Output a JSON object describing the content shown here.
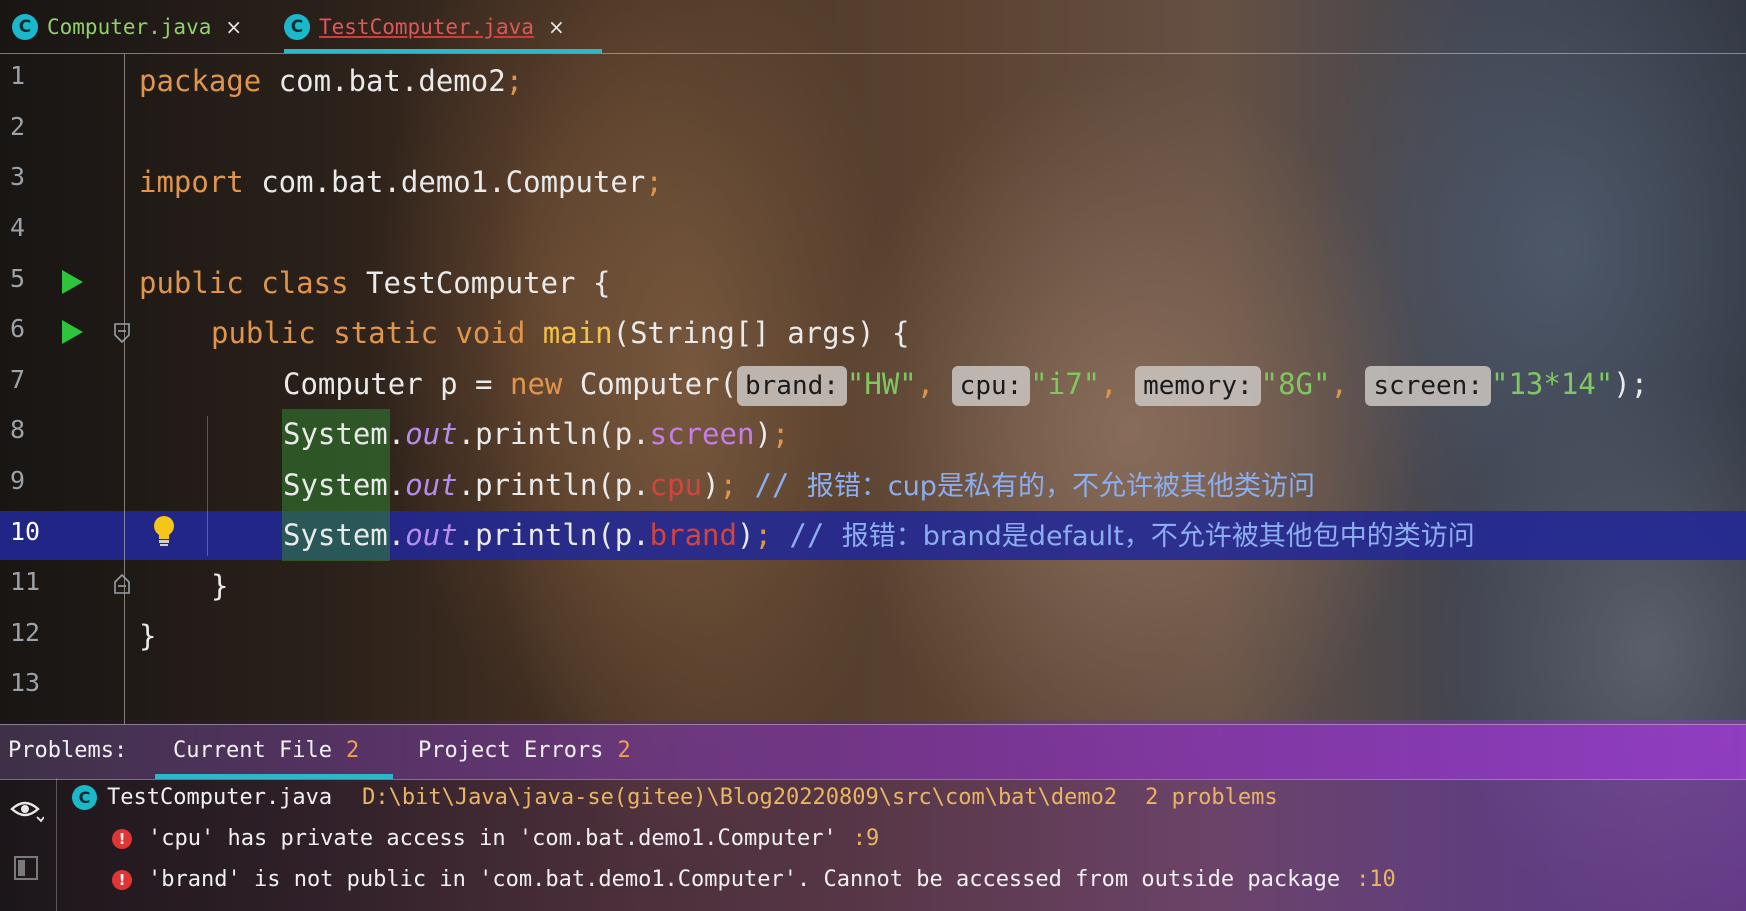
{
  "tabs": [
    {
      "label": "Computer.java",
      "icon": "java-class-icon",
      "close": "×",
      "active": false
    },
    {
      "label": "TestComputer.java",
      "icon": "java-class-icon",
      "close": "×",
      "active": true
    }
  ],
  "gutter": {
    "line_numbers": [
      "1",
      "2",
      "3",
      "4",
      "5",
      "6",
      "7",
      "8",
      "9",
      "10",
      "11",
      "12",
      "13"
    ],
    "current_line": "10"
  },
  "code": {
    "line1": {
      "kw": "package",
      "rest": " com.bat.demo2",
      "semi": ";"
    },
    "line3": {
      "kw": "import",
      "rest": " com.bat.demo1.Computer",
      "semi": ";"
    },
    "line5": {
      "kw1": "public",
      "kw2": "class",
      "name": " TestComputer {"
    },
    "line6": {
      "kw1": "public",
      "kw2": "static",
      "kw3": "void",
      "fn": "main",
      "rest": "(String[] args) {"
    },
    "line7": {
      "start": "Computer p = ",
      "kw": "new",
      "ctor": " Computer(",
      "hints": [
        {
          "label": "brand:",
          "value": "\"HW\""
        },
        {
          "label": "cpu:",
          "value": "\"i7\""
        },
        {
          "label": "memory:",
          "value": "\"8G\""
        },
        {
          "label": "screen:",
          "value": "\"13*14\""
        }
      ],
      "end": ");"
    },
    "line8": {
      "pre": "System.",
      "out": "out",
      "mid": ".println(p.",
      "field": "screen",
      "end": ")",
      "semi": ";"
    },
    "line9": {
      "pre": "System.",
      "out": "out",
      "mid": ".println(p.",
      "field": "cpu",
      "end": ")",
      "semi": ";",
      "comment_slash": " // ",
      "comment": "报错：cup是私有的，不允许被其他类访问"
    },
    "line10": {
      "pre": "System.",
      "out": "out",
      "mid": ".println(p.",
      "field": "brand",
      "end": ")",
      "semi": ";",
      "comment_slash": " // ",
      "comment": "报错：brand是default，不允许被其他包中的类访问"
    },
    "line11": {
      "text": "}"
    },
    "line12": {
      "text": "}"
    }
  },
  "problems": {
    "title": "Problems:",
    "tabs": [
      {
        "label": "Current File",
        "count": "2"
      },
      {
        "label": "Project Errors",
        "count": "2"
      }
    ],
    "file": {
      "name": "TestComputer.java",
      "path": "D:\\bit\\Java\\java-se(gitee)\\Blog20220809\\src\\com\\bat\\demo2",
      "count": "2 problems"
    },
    "errors": [
      {
        "message": "'cpu' has private access in 'com.bat.demo1.Computer'",
        "line": ":9"
      },
      {
        "message": "'brand' is not public in 'com.bat.demo1.Computer'. Cannot be accessed from outside package",
        "line": ":10"
      }
    ]
  },
  "colors": {
    "keyword": "#e0954c",
    "string": "#7fc85f",
    "field_error": "#d2443e",
    "comment": "#8caef0",
    "current_line": "#22289a",
    "accent": "#2fb6c8"
  }
}
